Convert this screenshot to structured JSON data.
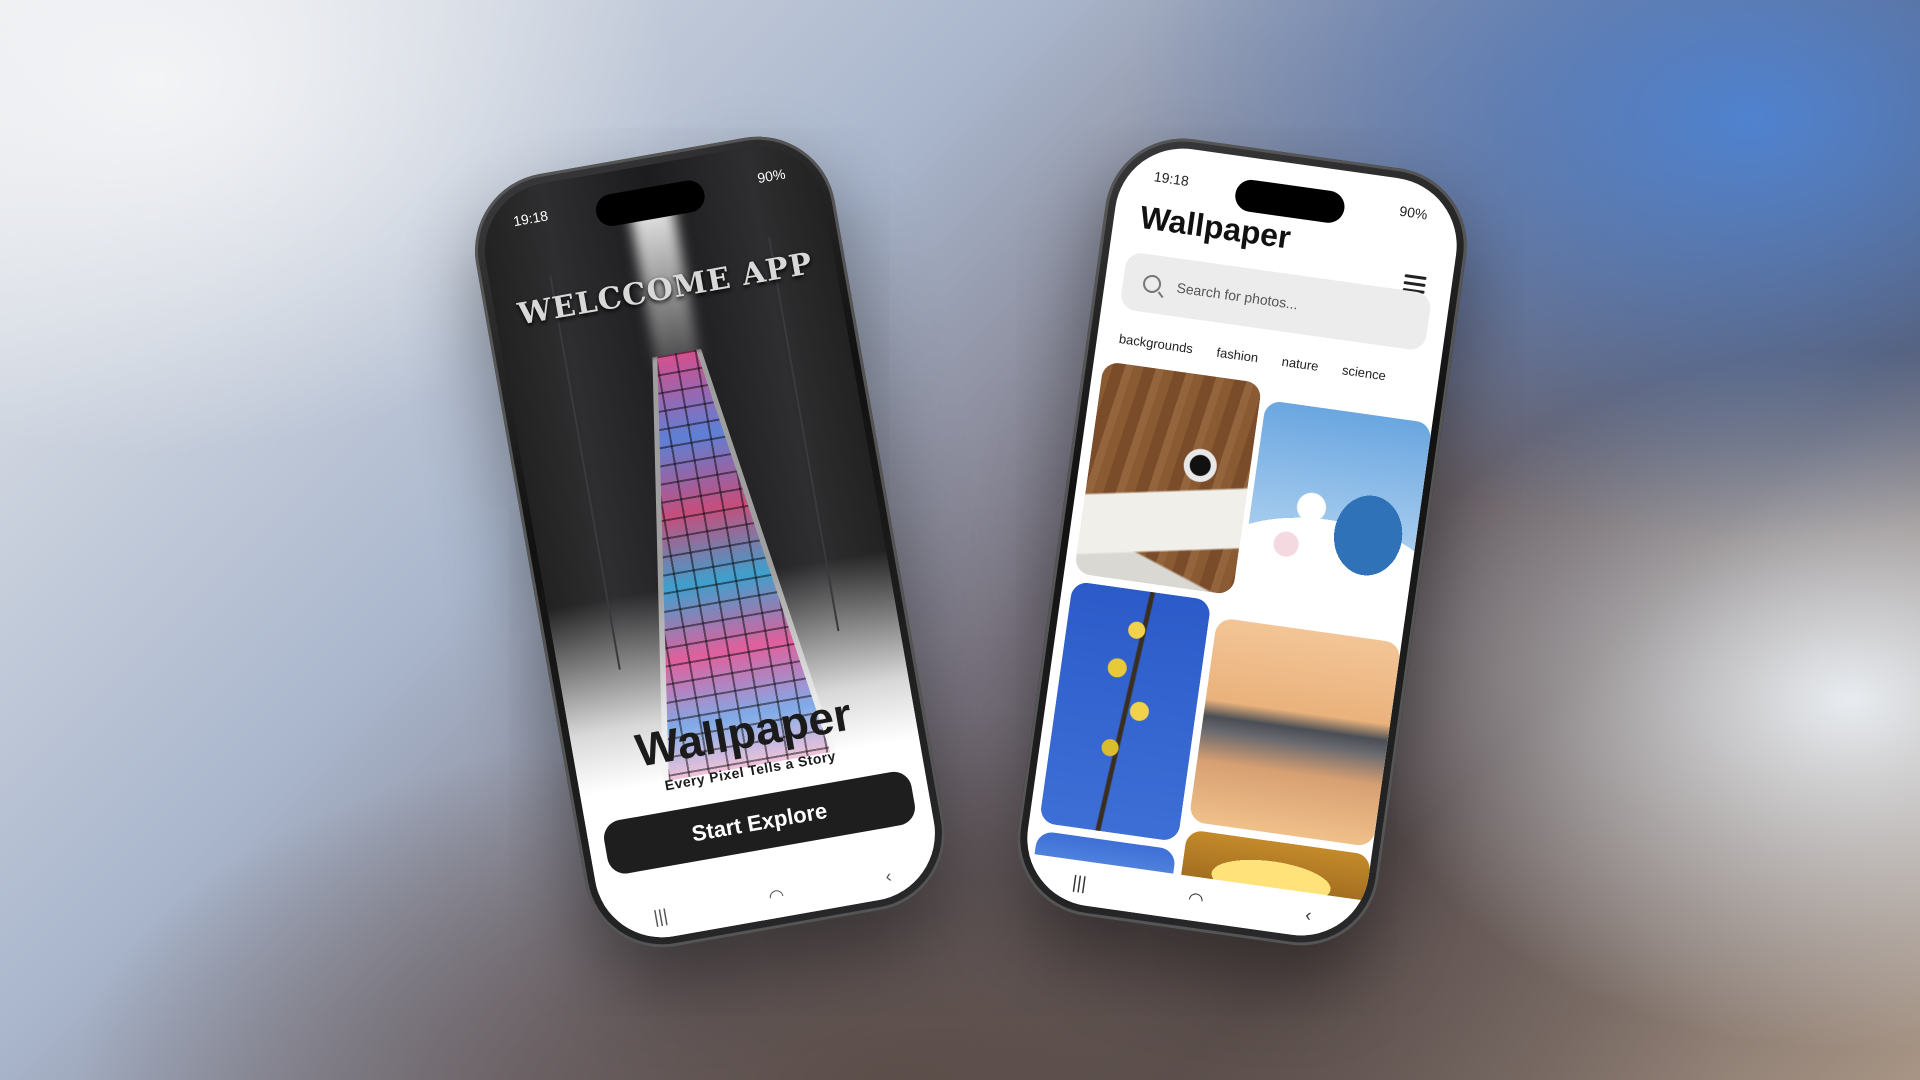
{
  "phone1": {
    "status": {
      "time": "19:18",
      "battery": "90%"
    },
    "welcome_title": "WELCCOME APP",
    "app_title": "Wallpaper",
    "tagline": "Every Pixel Tells a Story",
    "start_button": "Start Explore",
    "nav": {
      "recents": "|||",
      "home": "◠",
      "back": "‹"
    }
  },
  "phone2": {
    "status": {
      "time": "19:18",
      "battery": "90%"
    },
    "title": "Wallpaper",
    "search": {
      "placeholder": "Search for photos..."
    },
    "categories": [
      {
        "label": "backgrounds"
      },
      {
        "label": "fashion"
      },
      {
        "label": "nature"
      },
      {
        "label": "science"
      }
    ],
    "nav": {
      "recents": "|||",
      "home": "◠",
      "back": "‹"
    }
  }
}
